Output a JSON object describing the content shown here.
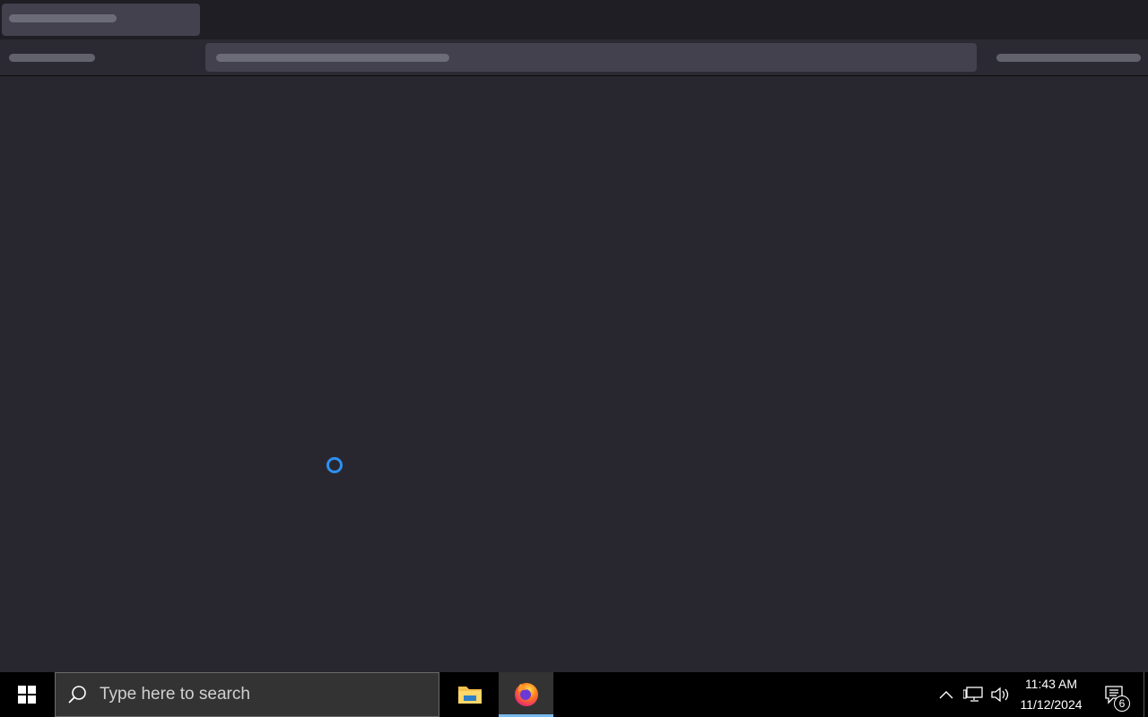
{
  "browser": {
    "state": "loading",
    "spinner_color": "#2f8ff0"
  },
  "taskbar": {
    "search_placeholder": "Type here to search",
    "apps": [
      {
        "name": "File Explorer",
        "icon": "folder-icon"
      },
      {
        "name": "Firefox",
        "icon": "firefox-icon",
        "active": true
      }
    ],
    "tray": {
      "icons": [
        "chevron-up-icon",
        "network-icon",
        "volume-icon"
      ],
      "time": "11:43 AM",
      "date": "11/12/2024",
      "notification_count": "6"
    }
  }
}
